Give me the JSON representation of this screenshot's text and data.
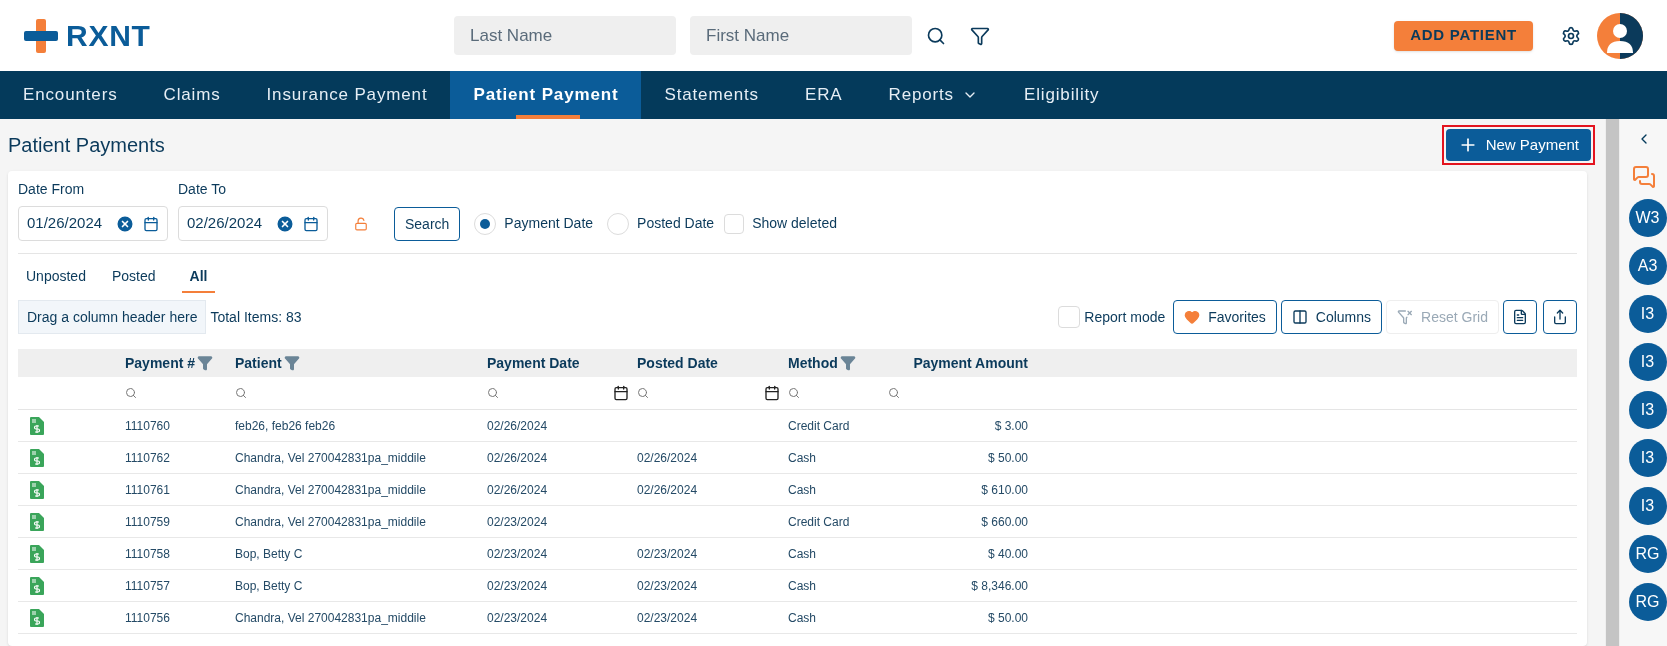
{
  "header": {
    "logo": "RXNT",
    "last_name": {
      "placeholder": "Last Name"
    },
    "first_name": {
      "placeholder": "First Name"
    },
    "add_patient": "ADD PATIENT"
  },
  "nav": [
    {
      "label": "Encounters",
      "selected": false,
      "dropdown": false
    },
    {
      "label": "Claims",
      "selected": false,
      "dropdown": false
    },
    {
      "label": "Insurance Payment",
      "selected": false,
      "dropdown": false
    },
    {
      "label": "Patient Payment",
      "selected": true,
      "dropdown": false
    },
    {
      "label": "Statements",
      "selected": false,
      "dropdown": false
    },
    {
      "label": "ERA",
      "selected": false,
      "dropdown": false
    },
    {
      "label": "Reports",
      "selected": false,
      "dropdown": true
    },
    {
      "label": "Eligibility",
      "selected": false,
      "dropdown": false
    }
  ],
  "page_title": "Patient Payments",
  "new_payment": "New Payment",
  "filters": {
    "date_from": {
      "label": "Date From",
      "value": "01/26/2024"
    },
    "date_to": {
      "label": "Date To",
      "value": "02/26/2024"
    },
    "search": "Search",
    "radios": [
      {
        "label": "Payment Date",
        "selected": true
      },
      {
        "label": "Posted Date",
        "selected": false
      }
    ],
    "show_deleted": {
      "label": "Show deleted",
      "checked": false
    }
  },
  "tabs": [
    {
      "label": "Unposted",
      "selected": false
    },
    {
      "label": "Posted",
      "selected": false
    },
    {
      "label": "All",
      "selected": true
    }
  ],
  "group_hint": "Drag a column header here",
  "total": "Total Items: 83",
  "report_mode": {
    "label": "Report mode",
    "checked": false
  },
  "toolbar": [
    {
      "kind": "favorites",
      "label": "Favorites",
      "disabled": false
    },
    {
      "kind": "columns",
      "label": "Columns",
      "disabled": false
    },
    {
      "kind": "reset",
      "label": "Reset Grid",
      "disabled": true
    }
  ],
  "table": {
    "columns": [
      {
        "label": "Payment #",
        "filter": true,
        "date": false
      },
      {
        "label": "Patient",
        "filter": true,
        "date": false
      },
      {
        "label": "Payment Date",
        "filter": false,
        "date": true
      },
      {
        "label": "Posted Date",
        "filter": false,
        "date": true
      },
      {
        "label": "Method",
        "filter": true,
        "date": false
      },
      {
        "label": "Payment Amount",
        "filter": false,
        "date": false
      }
    ],
    "rows": [
      [
        "1110760",
        "feb26, feb26 feb26",
        "02/26/2024",
        "",
        "Credit Card",
        "$ 3.00"
      ],
      [
        "1110762",
        "Chandra, Vel 270042831pa_middile",
        "02/26/2024",
        "02/26/2024",
        "Cash",
        "$ 50.00"
      ],
      [
        "1110761",
        "Chandra, Vel 270042831pa_middile",
        "02/26/2024",
        "02/26/2024",
        "Cash",
        "$ 610.00"
      ],
      [
        "1110759",
        "Chandra, Vel 270042831pa_middile",
        "02/23/2024",
        "",
        "Credit Card",
        "$ 660.00"
      ],
      [
        "1110758",
        "Bop, Betty C",
        "02/23/2024",
        "02/23/2024",
        "Cash",
        "$ 40.00"
      ],
      [
        "1110757",
        "Bop, Betty C",
        "02/23/2024",
        "02/23/2024",
        "Cash",
        "$ 8,346.00"
      ],
      [
        "1110756",
        "Chandra, Vel 270042831pa_middile",
        "02/23/2024",
        "02/23/2024",
        "Cash",
        "$ 50.00"
      ]
    ]
  },
  "sidebar": [
    "W3",
    "A3",
    "I3",
    "I3",
    "I3",
    "I3",
    "I3",
    "RG",
    "RG"
  ]
}
